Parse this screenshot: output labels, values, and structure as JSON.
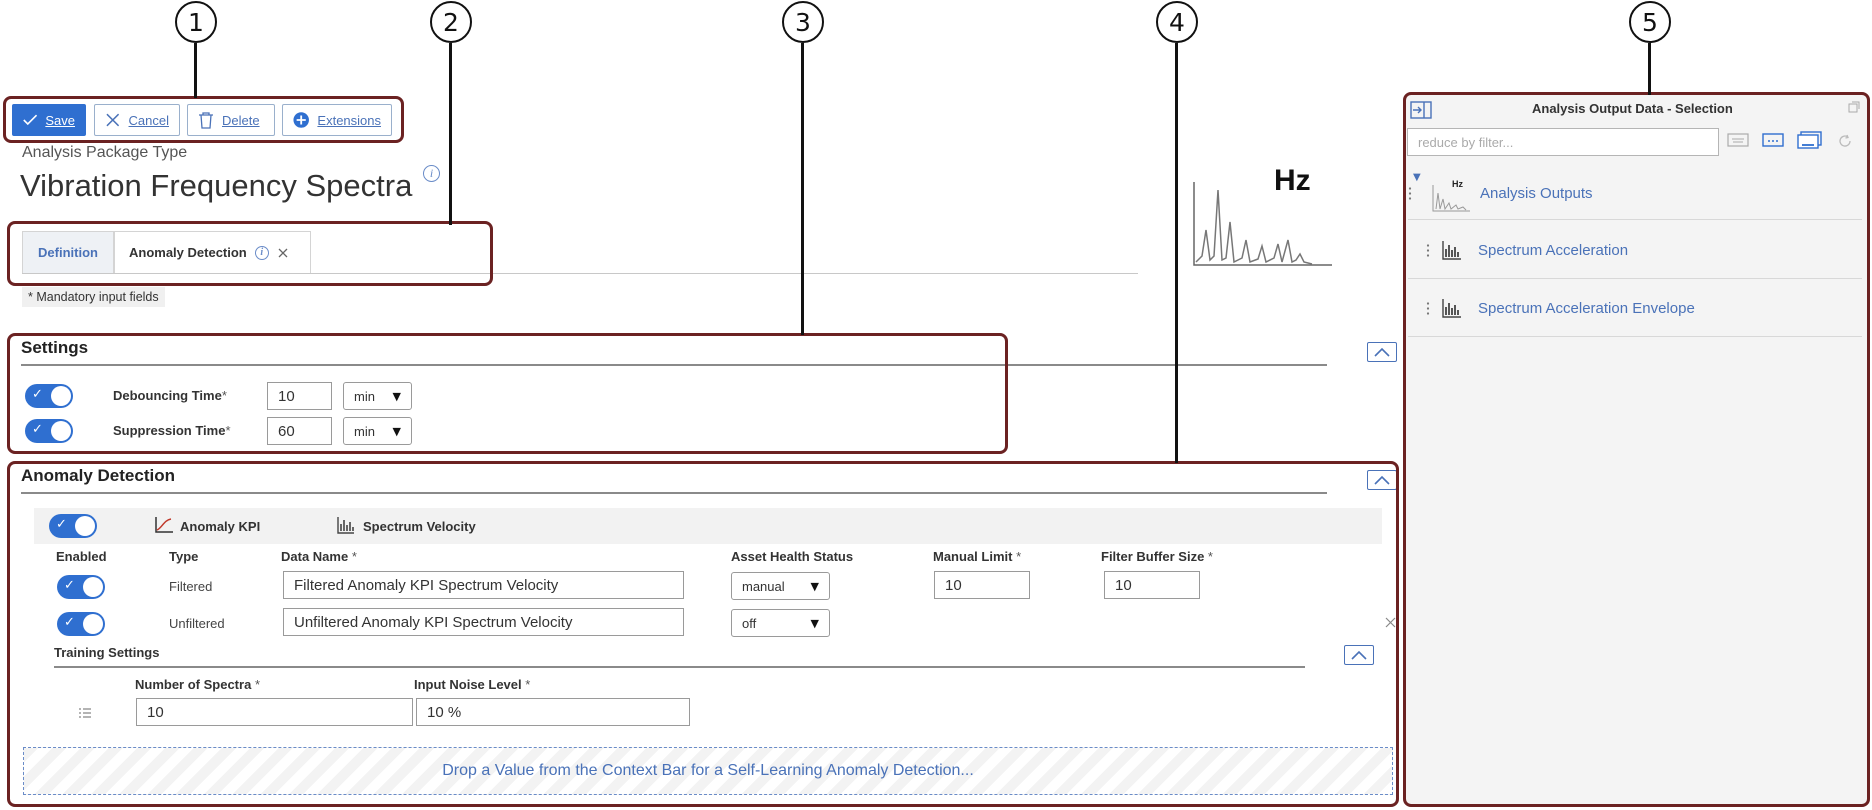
{
  "callouts": [
    "1",
    "2",
    "3",
    "4",
    "5"
  ],
  "toolbar": {
    "save_label": "Save",
    "cancel_label": "Cancel",
    "delete_label": "Delete",
    "extensions_label": "Extensions"
  },
  "header": {
    "package_type_label": "Analysis Package Type",
    "package_title": "Vibration Frequency Spectra",
    "info_glyph": "i",
    "unit_badge": "Hz"
  },
  "tabs": [
    {
      "label": "Definition"
    },
    {
      "label": "Anomaly Detection"
    }
  ],
  "mandatory_note": "* Mandatory input fields",
  "settings": {
    "title": "Settings",
    "rows": [
      {
        "label": "Debouncing Time",
        "value": "10",
        "unit": "min"
      },
      {
        "label": "Suppression Time",
        "value": "60",
        "unit": "min"
      }
    ]
  },
  "anomaly": {
    "title": "Anomaly Detection",
    "kpi_label": "Anomaly KPI",
    "spectrum_label": "Spectrum Velocity",
    "columns": {
      "enabled": "Enabled",
      "type": "Type",
      "data_name": "Data Name",
      "asset_health": "Asset Health Status",
      "manual_limit": "Manual Limit",
      "filter_buffer": "Filter Buffer Size"
    },
    "rows": [
      {
        "type": "Filtered",
        "data_name": "Filtered Anomaly KPI Spectrum Velocity",
        "asset_health": "manual",
        "manual_limit": "10",
        "filter_buffer": "10"
      },
      {
        "type": "Unfiltered",
        "data_name": "Unfiltered Anomaly KPI Spectrum Velocity",
        "asset_health": "off"
      }
    ],
    "training": {
      "title": "Training Settings",
      "num_spectra_label": "Number of Spectra",
      "num_spectra_value": "10",
      "noise_label": "Input Noise Level",
      "noise_value": "10 %"
    },
    "dropzone_text": "Drop a Value from the Context Bar for a Self-Learning Anomaly Detection..."
  },
  "right_panel": {
    "title": "Analysis Output Data - Selection",
    "filter_placeholder": "reduce by filter...",
    "root_label": "Analysis Outputs",
    "root_badge": "Hz",
    "items": [
      {
        "label": "Spectrum Acceleration"
      },
      {
        "label": "Spectrum Acceleration Envelope"
      }
    ]
  },
  "colors": {
    "frame": "#6b2222",
    "accent": "#2f6fd0",
    "link": "#4a72b8"
  }
}
